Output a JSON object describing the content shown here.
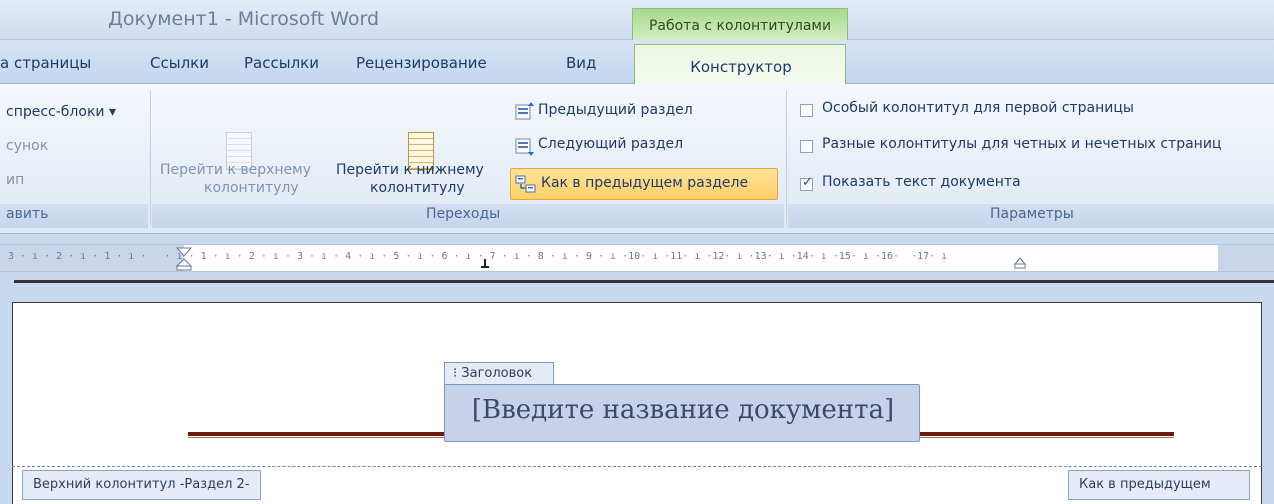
{
  "titlebar": {
    "title": "Документ1 - Microsoft Word",
    "context_tab": "Работа с колонтитулами"
  },
  "tabs": {
    "items": [
      "а страницы",
      "Ссылки",
      "Рассылки",
      "Рецензирование",
      "Вид"
    ],
    "active": "Конструктор"
  },
  "ribbon": {
    "insert_group": {
      "items": [
        "спресс-блоки ▾",
        "сунок",
        "ип"
      ],
      "label": "авить"
    },
    "nav_group": {
      "prev_header_line1": "Перейти к верхнему",
      "prev_header_line2": "колонтитулу",
      "next_footer_line1": "Перейти к нижнему",
      "next_footer_line2": "колонтитулу",
      "prev_section": "Предыдущий раздел",
      "next_section": "Следующий раздел",
      "link_previous": "Как в предыдущем разделе",
      "label": "Переходы"
    },
    "options_group": {
      "first_page": "Особый колонтитул для первой страницы",
      "odd_even": "Разные колонтитулы для четных и нечетных страниц",
      "show_text": "Показать текст документа",
      "label": "Параметры",
      "first_page_checked": false,
      "odd_even_checked": false,
      "show_text_checked": true
    }
  },
  "ruler": {
    "text": "3 · ı · 2 · ı · 1 · ı ·   · ı · 1 · ı · 2 · ı · 3 · ı · 4 · ı · 5 · ı · 6 · ı · 7 · ı · 8 · ı · 9 · ı ·10· ı ·11· ı ·12· ı ·13· ı ·14· ı ·15· ı ·16·  ·17· ı"
  },
  "document": {
    "heading_tag": "⁝ Заголовок",
    "title_placeholder": "[Введите название документа]",
    "header_label": "Верхний колонтитул -Раздел 2-",
    "same_as_previous": "Как в предыдущем"
  }
}
